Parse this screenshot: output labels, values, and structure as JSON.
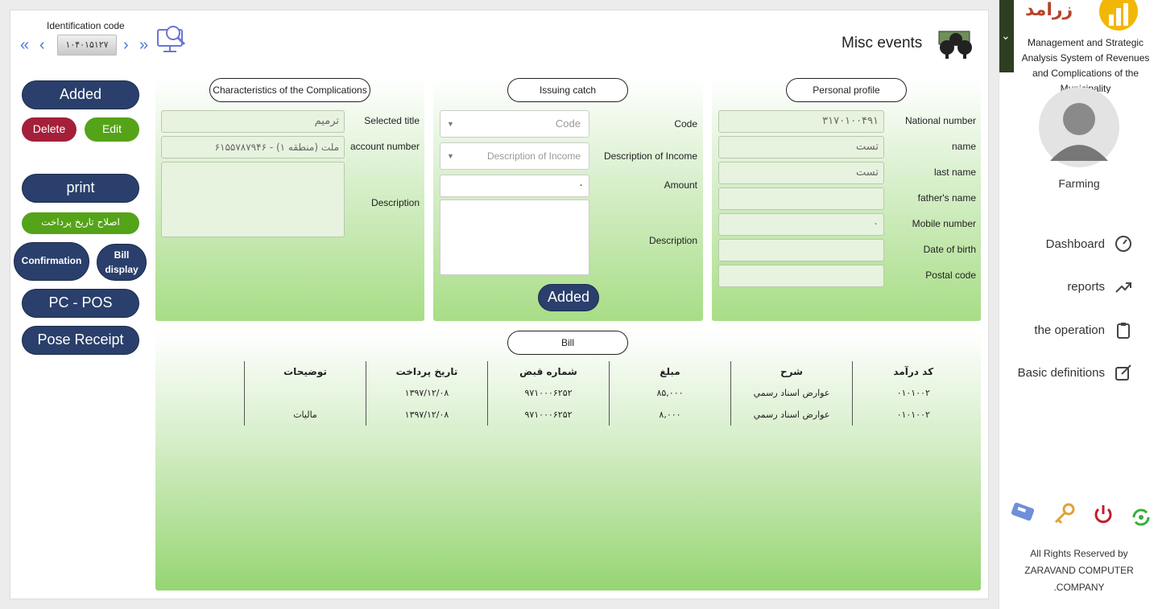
{
  "header": {
    "title": "Misc events",
    "id_label": "Identification code",
    "id_value": "۱۰۴۰۱۵۱۲۷",
    "nav_first": "«",
    "nav_prev": "‹",
    "nav_next": "›",
    "nav_last": "»"
  },
  "actions": {
    "added": "Added",
    "delete": "Delete",
    "edit": "Edit",
    "print": "print",
    "fix_date": "اصلاح تاریخ پرداخت",
    "confirmation": "Confirmation",
    "bill_display_1": "Bill",
    "bill_display_2": "display",
    "pc_pos": "PC - POS",
    "pose_receipt": "Pose Receipt"
  },
  "complications": {
    "title": "Characteristics of the Complications",
    "selected_title_label": "Selected title",
    "selected_title_value": "ترمیم",
    "account_label": "account number",
    "account_value": "ملت (منطقه ۱) - ۶۱۵۵۷۸۷۹۴۶",
    "description_label": "Description"
  },
  "issuing": {
    "title": "Issuing catch",
    "code_label": "Code",
    "code_placeholder": "Code",
    "income_label": "Description of Income",
    "income_placeholder": "Description of Income",
    "amount_label": "Amount",
    "amount_value": "۰",
    "description_label": "Description",
    "added": "Added"
  },
  "profile": {
    "title": "Personal profile",
    "fields": [
      {
        "label": "National number",
        "value": "۳۱۷۰۱۰۰۴۹۱"
      },
      {
        "label": "name",
        "value": "تست"
      },
      {
        "label": "last name",
        "value": "تست"
      },
      {
        "label": "father's name",
        "value": ""
      },
      {
        "label": "Mobile number",
        "value": "۰"
      },
      {
        "label": "Date of birth",
        "value": ""
      },
      {
        "label": "Postal code",
        "value": ""
      }
    ]
  },
  "bill": {
    "title": "Bill",
    "headers": [
      "کد درآمد",
      "شرح",
      "مبلغ",
      "شماره قبض",
      "تاریخ پرداخت",
      "توضیحات"
    ],
    "rows": [
      [
        "۰۱۰۱۰۰۲",
        "عوارض اسناد رسمي",
        "۸۵,۰۰۰",
        "۹۷۱۰۰۰۶۲۵۲",
        "۱۳۹۷/۱۲/۰۸",
        ""
      ],
      [
        "۰۱۰۱۰۰۲",
        "عوارض اسناد رسمي",
        "۸,۰۰۰",
        "۹۷۱۰۰۰۶۲۵۲",
        "۱۳۹۷/۱۲/۰۸",
        "ماليات"
      ]
    ]
  },
  "sidebar": {
    "logo_text": "زرامد",
    "system_title": "Management and Strategic Analysis System of Revenues and Complications of the Municipality",
    "user": "Farming",
    "menu": [
      {
        "label": "Dashboard",
        "icon": "dashboard-gauge-icon"
      },
      {
        "label": "reports",
        "icon": "trending-up-icon"
      },
      {
        "label": "the operation",
        "icon": "clipboard-icon"
      },
      {
        "label": "Basic definitions",
        "icon": "edit-icon"
      }
    ],
    "footer_1": "All Rights Reserved by",
    "footer_2": "ZARAVAND COMPUTER",
    "footer_3": ".COMPANY"
  },
  "colors": {
    "navy": "#2a3f6b",
    "red": "#a31f3a",
    "green": "#55a318",
    "accent_blue": "#4a7fd4"
  }
}
